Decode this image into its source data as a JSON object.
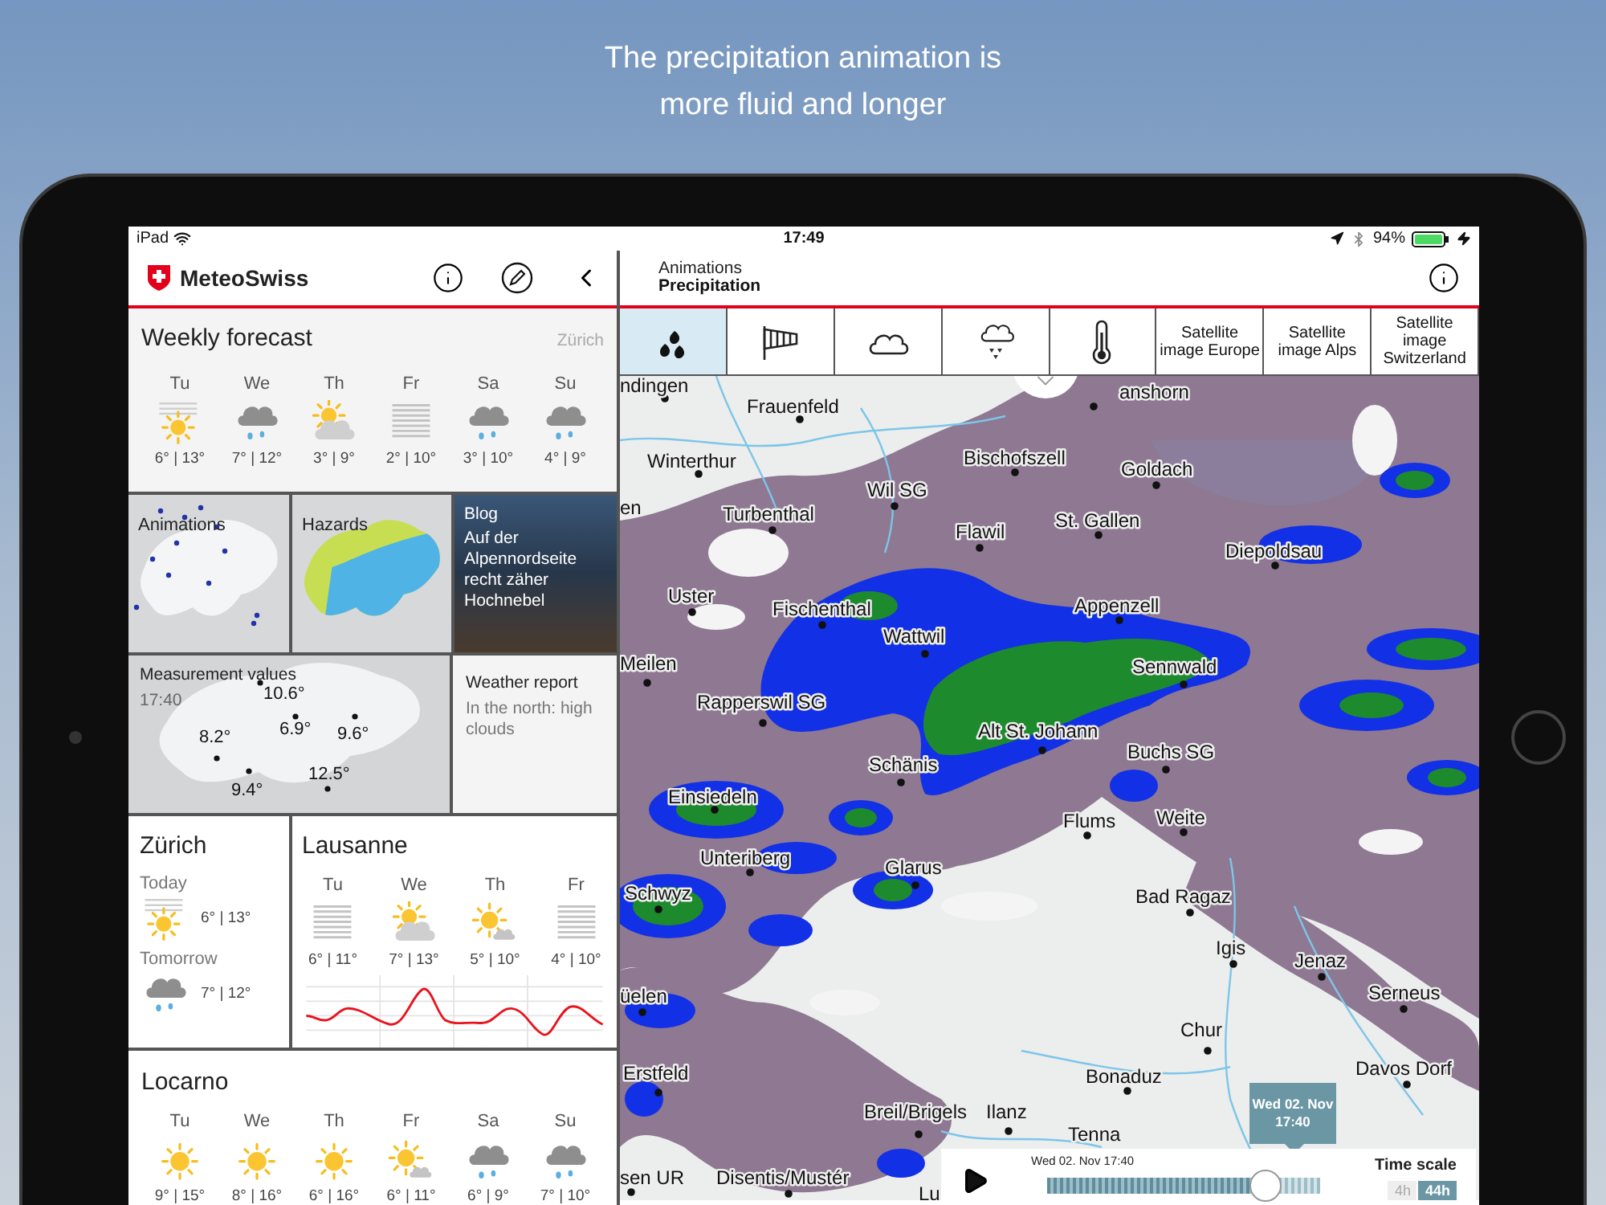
{
  "caption": [
    "The precipitation animation is",
    "more fluid and longer"
  ],
  "status_bar": {
    "carrier": "iPad",
    "time": "17:49",
    "battery": "94%"
  },
  "sidebar": {
    "app_title": "MeteoSwiss",
    "weekly_forecast": {
      "title": "Weekly forecast",
      "location": "Zürich",
      "days": [
        {
          "day": "Tu",
          "kind": "hazy-sun",
          "temps": "6° | 13°"
        },
        {
          "day": "We",
          "kind": "rain",
          "temps": "7° | 12°"
        },
        {
          "day": "Th",
          "kind": "cloud-sun",
          "temps": "3° | 9°"
        },
        {
          "day": "Fr",
          "kind": "fog",
          "temps": "2° | 10°"
        },
        {
          "day": "Sa",
          "kind": "rain",
          "temps": "3° | 10°"
        },
        {
          "day": "Su",
          "kind": "rain",
          "temps": "4° | 9°"
        }
      ]
    },
    "tiles": [
      {
        "kind": "animations",
        "title": "Animations"
      },
      {
        "kind": "hazards",
        "title": "Hazards"
      },
      {
        "kind": "blog",
        "title": "Blog",
        "text": "Auf der Alpennordseite recht zäher Hochnebel"
      }
    ],
    "measurement": {
      "title": "Measurement values",
      "time": "17:40",
      "values": [
        "10.6°",
        "8.2°",
        "6.9°",
        "9.6°",
        "9.4°",
        "12.5°"
      ]
    },
    "weather_report": {
      "title": "Weather report",
      "text": "In the north: high clouds"
    },
    "zurich": {
      "title": "Zürich",
      "periods": [
        {
          "label": "Today",
          "kind": "hazy-sun",
          "temps": "6° | 13°"
        },
        {
          "label": "Tomorrow",
          "kind": "rain",
          "temps": "7° | 12°"
        }
      ]
    },
    "lausanne": {
      "title": "Lausanne",
      "days": [
        {
          "day": "Tu",
          "kind": "fog",
          "temps": "6° | 11°"
        },
        {
          "day": "We",
          "kind": "cloud-sun",
          "temps": "7° | 13°"
        },
        {
          "day": "Th",
          "kind": "partly",
          "temps": "5° | 10°"
        },
        {
          "day": "Fr",
          "kind": "fog",
          "temps": "4° | 10°"
        }
      ]
    },
    "locarno": {
      "title": "Locarno",
      "days": [
        {
          "day": "Tu",
          "kind": "sunny",
          "temps": "9° | 15°"
        },
        {
          "day": "We",
          "kind": "sunny",
          "temps": "8° | 16°"
        },
        {
          "day": "Th",
          "kind": "sunny",
          "temps": "6° | 16°"
        },
        {
          "day": "Fr",
          "kind": "partly",
          "temps": "6° | 11°"
        },
        {
          "day": "Sa",
          "kind": "rain",
          "temps": "6° | 9°"
        },
        {
          "day": "Su",
          "kind": "rain",
          "temps": "7° | 10°"
        }
      ]
    }
  },
  "main": {
    "header": {
      "category": "Animations",
      "title": "Precipitation"
    },
    "tabs": [
      {
        "kind": "drops",
        "selected": true
      },
      {
        "kind": "windsock",
        "selected": false
      },
      {
        "kind": "cloud",
        "selected": false
      },
      {
        "kind": "snow-cloud",
        "selected": false
      },
      {
        "kind": "thermometer",
        "selected": false
      },
      {
        "kind": "text",
        "label": "Satellite image Europe",
        "selected": false
      },
      {
        "kind": "text",
        "label": "Satellite image Alps",
        "selected": false
      },
      {
        "kind": "text",
        "label": "Satellite image Switzerland",
        "selected": false
      }
    ],
    "map": {
      "places": [
        "ndingen",
        "Frauenfeld",
        "anshorn",
        "Winterthur",
        "en",
        "Wil SG",
        "Bischofszell",
        "Goldach",
        "Turbenthal",
        "Flawil",
        "St. Gallen",
        "Diepoldsau",
        "Uster",
        "Fischenthal",
        "Appenzell",
        "Wattwil",
        "Meilen",
        "Sennwald",
        "Rapperswil SG",
        "Alt St. Johann",
        "Buchs SG",
        "Schänis",
        "Einsiedeln",
        "Flums",
        "Weite",
        "Unteriberg",
        "Glarus",
        "Schwyz",
        "Bad Ragaz",
        "Igis",
        "Jenaz",
        "üelen",
        "Serneus",
        "Chur",
        "Erstfeld",
        "Davos Dorf",
        "Bonaduz",
        "Breil/Brigels",
        "Ilanz",
        "Tenna",
        "sen UR",
        "Disentis/Mustér",
        "Lu"
      ]
    },
    "time_tooltip": [
      "Wed 02. Nov",
      "17:40"
    ],
    "player": {
      "timestamp": "Wed 02. Nov 17:40",
      "level": 0.8,
      "time_scale_label": "Time scale",
      "scales": [
        {
          "label": "4h",
          "selected": false
        },
        {
          "label": "44h",
          "selected": true
        }
      ]
    }
  }
}
